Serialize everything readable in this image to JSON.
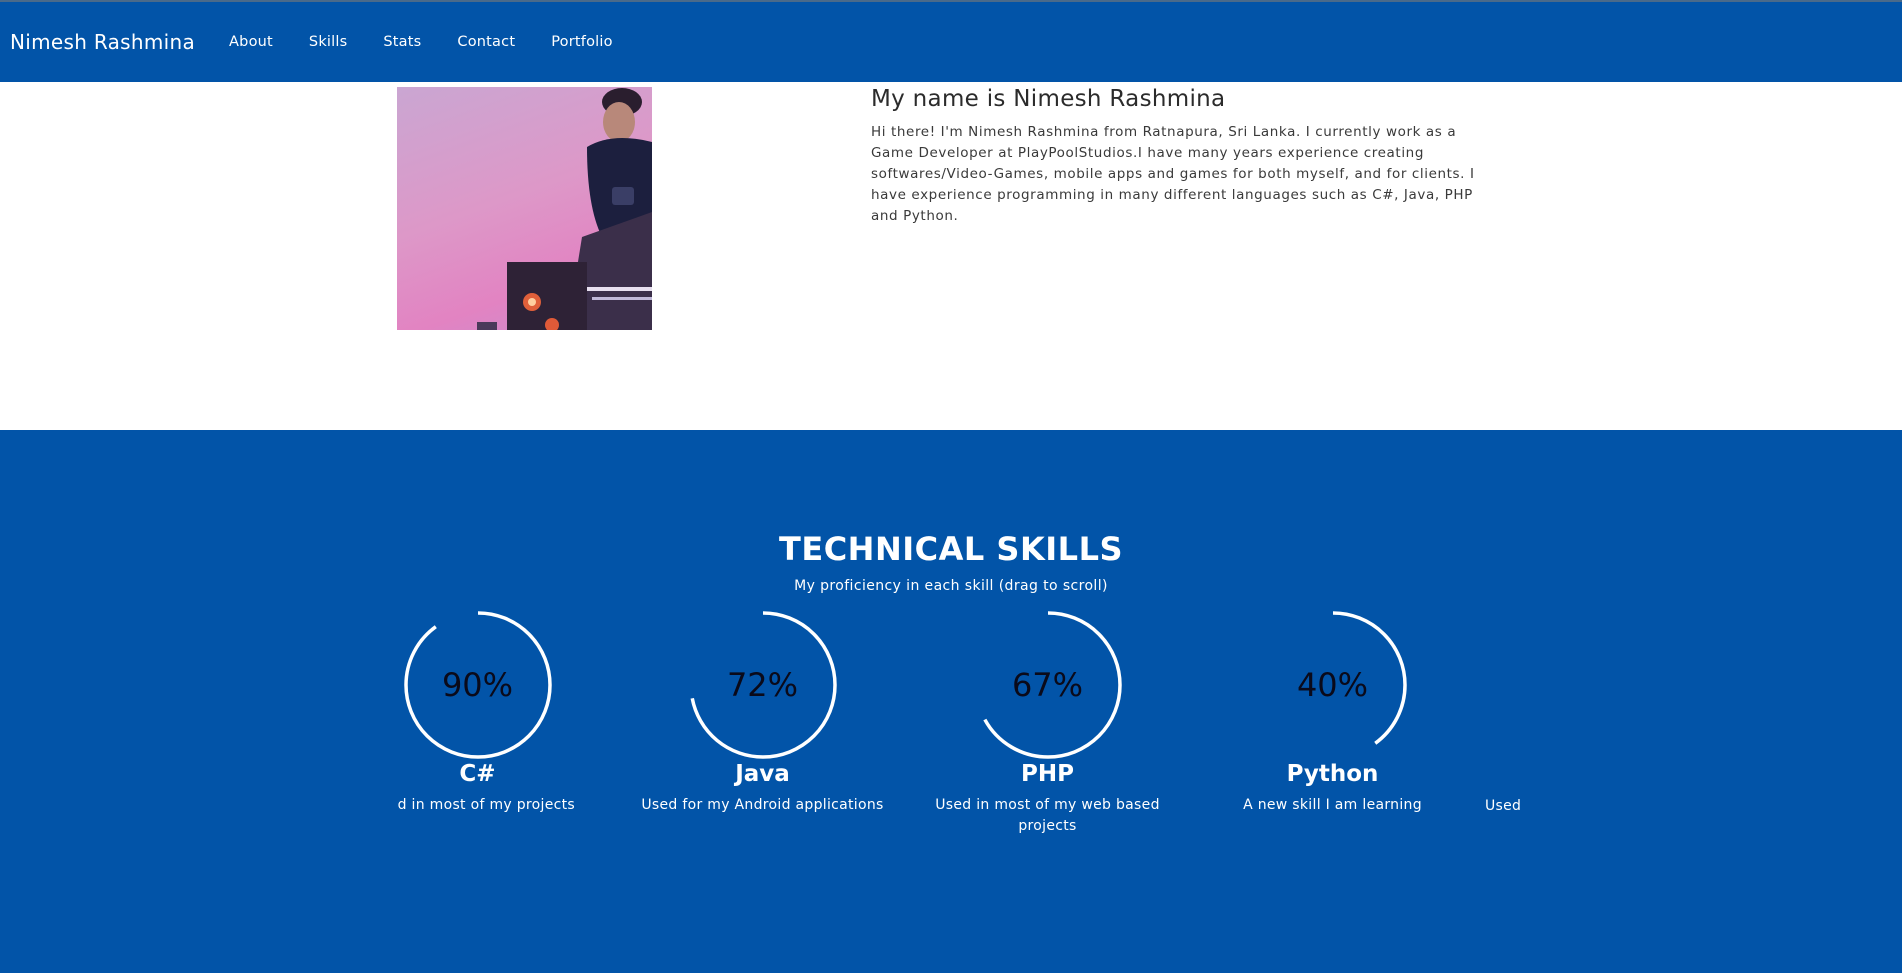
{
  "nav": {
    "brand": "Nimesh Rashmina",
    "links": [
      "About",
      "Skills",
      "Stats",
      "Contact",
      "Portfolio"
    ]
  },
  "about": {
    "heading": "My name is Nimesh Rashmina",
    "text": "Hi there! I'm Nimesh Rashmina from Ratnapura, Sri Lanka. I currently work as a Game Developer at PlayPoolStudios.I have many years experience creating softwares/Video-Games, mobile apps and games for both myself, and for clients. I have experience programming in many different languages such as C#, Java, PHP and Python."
  },
  "skills": {
    "title": "TECHNICAL SKILLS",
    "subtitle": "My proficiency in each skill (drag to scroll)",
    "items": [
      {
        "name": "C#",
        "percent": 90,
        "percent_label": "90%",
        "description": "d in most of my projects"
      },
      {
        "name": "Java",
        "percent": 72,
        "percent_label": "72%",
        "description": "Used for my Android applications"
      },
      {
        "name": "PHP",
        "percent": 67,
        "percent_label": "67%",
        "description": "Used in most of my web based projects"
      },
      {
        "name": "Python",
        "percent": 40,
        "percent_label": "40%",
        "description": "A new skill I am learning"
      },
      {
        "name": "",
        "percent": null,
        "percent_label": "",
        "description": "Used"
      }
    ]
  },
  "colors": {
    "brand_blue": "#0254a8",
    "ring": "#ffffff",
    "text_dark": "#2b2b2b"
  }
}
